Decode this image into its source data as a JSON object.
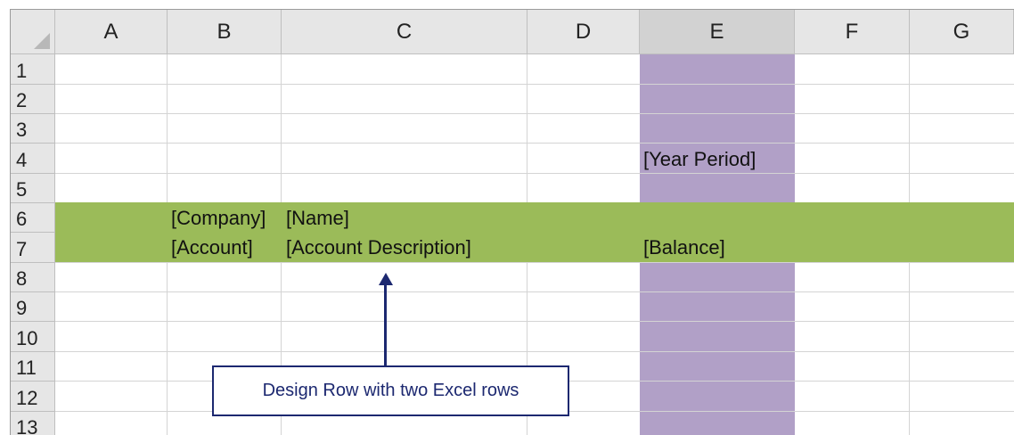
{
  "columns": [
    "A",
    "B",
    "C",
    "D",
    "E",
    "F",
    "G"
  ],
  "rows": [
    "1",
    "2",
    "3",
    "4",
    "5",
    "6",
    "7",
    "8",
    "9",
    "10",
    "11",
    "12",
    "13"
  ],
  "cells": {
    "E4": "[Year Period]",
    "B6": "[Company]",
    "C6": "[Name]",
    "B7": "[Account]",
    "C7": "[Account Description]",
    "E7": "[Balance]"
  },
  "callout": {
    "text": "Design Row with two Excel rows"
  },
  "colors": {
    "design_row": "#9bbb59",
    "column_band": "#b1a0c7",
    "callout_border": "#1c2870"
  }
}
